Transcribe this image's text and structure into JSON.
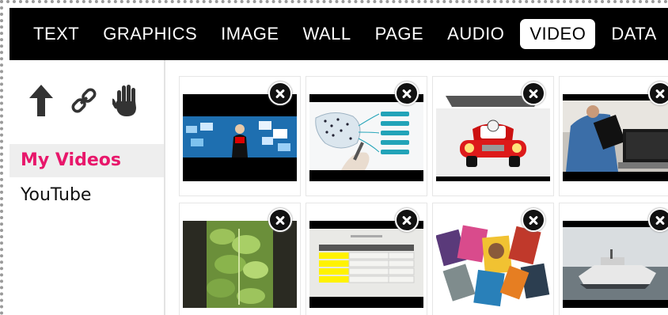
{
  "tabs": [
    {
      "label": "TEXT",
      "active": false
    },
    {
      "label": "GRAPHICS",
      "active": false
    },
    {
      "label": "IMAGE",
      "active": false
    },
    {
      "label": "WALL",
      "active": false
    },
    {
      "label": "PAGE",
      "active": false
    },
    {
      "label": "AUDIO",
      "active": false
    },
    {
      "label": "VIDEO",
      "active": true
    },
    {
      "label": "DATA",
      "active": false
    }
  ],
  "toolbar": {
    "icons": [
      "upload-arrow-icon",
      "link-icon",
      "hand-icon"
    ]
  },
  "sources": [
    {
      "label": "My Videos",
      "active": true
    },
    {
      "label": "YouTube",
      "active": false
    }
  ],
  "videos": [
    {
      "thumb": "presenter-blue-screen"
    },
    {
      "thumb": "whiteboard-map-diagram"
    },
    {
      "thumb": "red-cartoon-car"
    },
    {
      "thumb": "man-with-laptop"
    },
    {
      "thumb": "green-plants"
    },
    {
      "thumb": "slide-table"
    },
    {
      "thumb": "magazines-collage"
    },
    {
      "thumb": "boat-on-water"
    }
  ],
  "colors": {
    "accent": "#e8176b",
    "topbar": "#000000",
    "sidebar_active_bg": "#eeeeee"
  }
}
